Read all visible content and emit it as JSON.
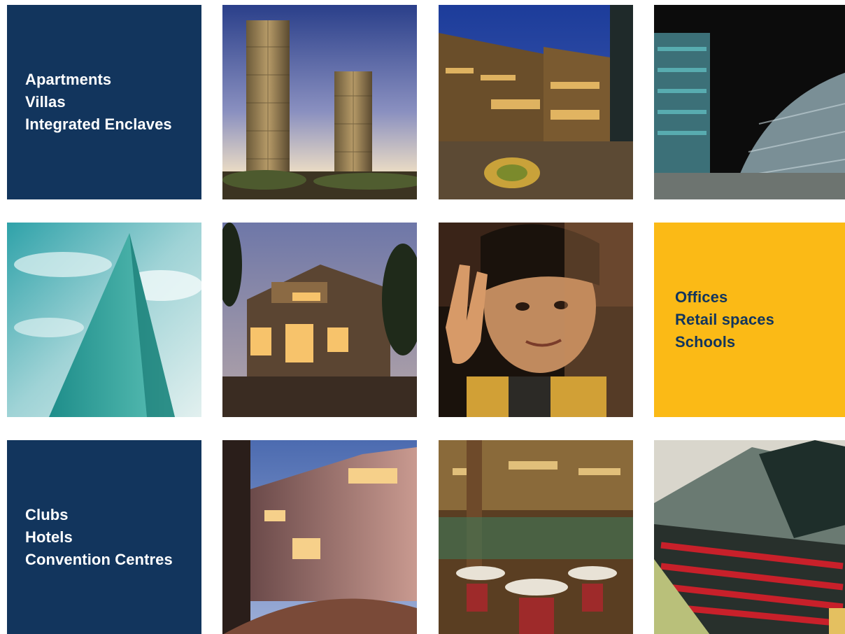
{
  "tiles": {
    "residential": {
      "lines": [
        "Apartments",
        "Villas",
        "Integrated Enclaves"
      ],
      "color": "#12355d",
      "text_color": "#ffffff"
    },
    "commercial": {
      "lines": [
        "Offices",
        "Retail spaces",
        "Schools"
      ],
      "color": "#fbba16",
      "text_color": "#12355d"
    },
    "hospitality": {
      "lines": [
        "Clubs",
        "Hotels",
        "Convention Centres"
      ],
      "color": "#12355d",
      "text_color": "#ffffff"
    }
  }
}
